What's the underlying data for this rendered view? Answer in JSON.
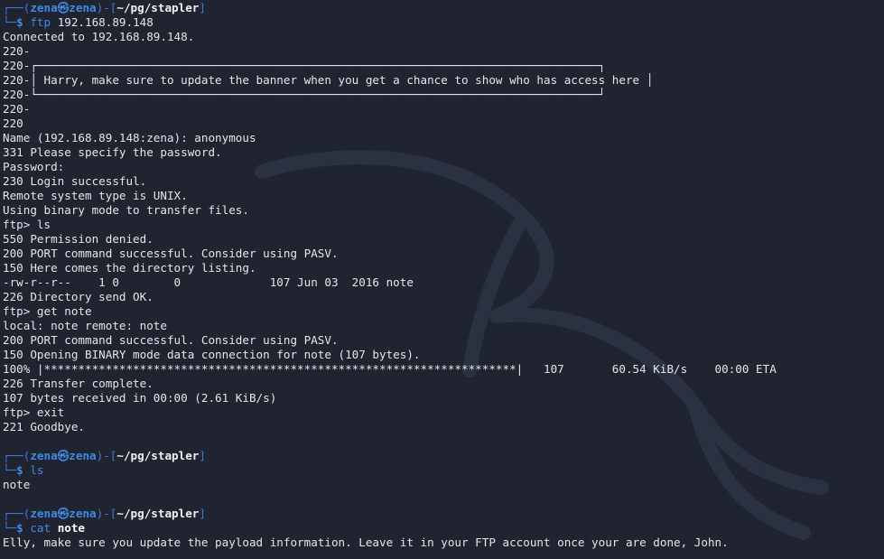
{
  "prompt": {
    "box_top": "┌──(",
    "user": "zena",
    "at_symbol": "㉿",
    "host": "zena",
    "mid": ")-[",
    "path": "~/pg/stapler",
    "close": "]",
    "box_bottom": "└─",
    "dollar": "$ "
  },
  "block1": {
    "command": "ftp",
    "argument": "192.168.89.148",
    "output": [
      "Connected to 192.168.89.148.",
      "220-",
      "220-┌──────────────────────────────────────────────────────────────────────────────────┐",
      "220-│ Harry, make sure to update the banner when you get a chance to show who has access here │",
      "220-└──────────────────────────────────────────────────────────────────────────────────┘",
      "220-",
      "220",
      "Name (192.168.89.148:zena): anonymous",
      "331 Please specify the password.",
      "Password:",
      "230 Login successful.",
      "Remote system type is UNIX.",
      "Using binary mode to transfer files.",
      "ftp> ls",
      "550 Permission denied.",
      "200 PORT command successful. Consider using PASV.",
      "150 Here comes the directory listing.",
      "-rw-r--r--    1 0        0             107 Jun 03  2016 note",
      "226 Directory send OK.",
      "ftp> get note",
      "local: note remote: note",
      "200 PORT command successful. Consider using PASV.",
      "150 Opening BINARY mode data connection for note (107 bytes).",
      "100% |*********************************************************************|   107       60.54 KiB/s    00:00 ETA",
      "226 Transfer complete.",
      "107 bytes received in 00:00 (2.61 KiB/s)",
      "ftp> exit",
      "221 Goodbye."
    ]
  },
  "block2": {
    "command": "ls",
    "output": [
      "note"
    ]
  },
  "block3": {
    "command": "cat",
    "argument": "note",
    "output": [
      "Elly, make sure you update the payload information. Leave it in your FTP account once your are done, John."
    ]
  },
  "colors": {
    "background": "#1f2430",
    "prompt_blue": "#3f8ae4",
    "text": "#e6e6e6"
  }
}
